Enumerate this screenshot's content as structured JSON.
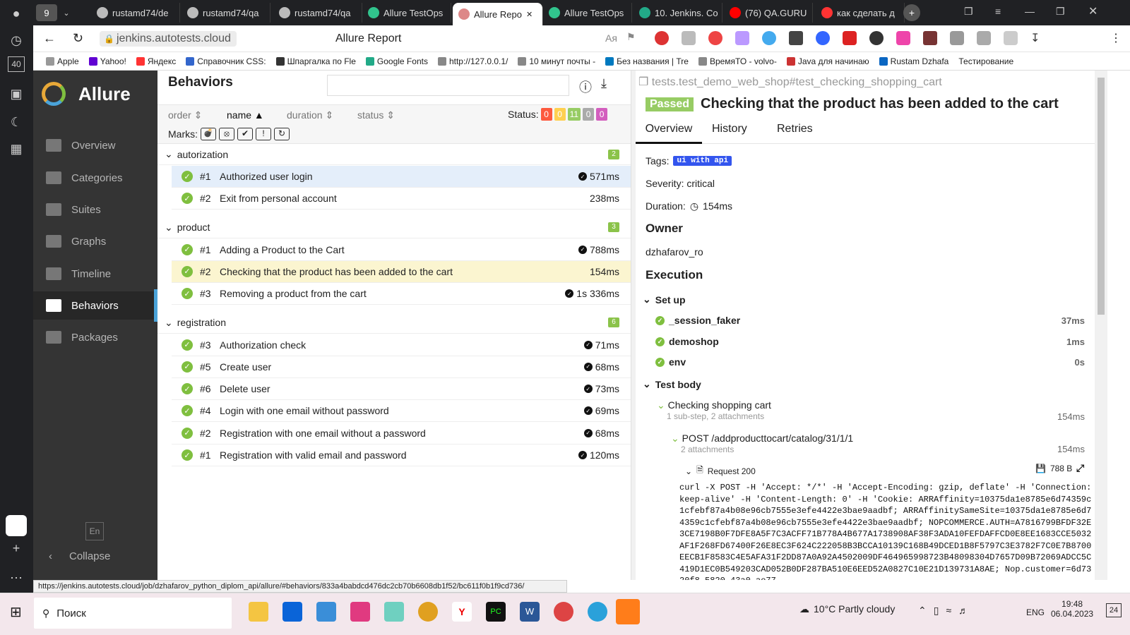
{
  "browser": {
    "tab_count": "9",
    "tabs": [
      {
        "label": "rustamd74/de",
        "color": "#bbb"
      },
      {
        "label": "rustamd74/qa",
        "color": "#bbb"
      },
      {
        "label": "rustamd74/qa",
        "color": "#bbb"
      },
      {
        "label": "Allure TestOps",
        "color": "#31c48d"
      },
      {
        "label": "Allure Repo",
        "color": "#d88"
      },
      {
        "label": "Allure TestOps",
        "color": "#31c48d"
      },
      {
        "label": "10. Jenkins. Co",
        "color": "#2a8"
      },
      {
        "label": "(76) QA.GURU",
        "color": "#f00"
      },
      {
        "label": "как сделать д",
        "color": "#f33"
      }
    ],
    "url": "jenkins.autotests.cloud",
    "page_title": "Allure Report",
    "side_badge": "40",
    "bookmarks": [
      "Apple",
      "Yahoo!",
      "Яндекс",
      "Справочник CSS:",
      "Шпаргалка по Fle",
      "Google Fonts",
      "http://127.0.0.1/",
      "10 минут почты -",
      "Без названия | Tre",
      "ВремяТО - volvo-",
      "Java для начинаю",
      "Rustam Dzhafa",
      "Тестирование"
    ],
    "status_url": "https://jenkins.autotests.cloud/job/dzhafarov_python_diplom_api/allure/#behaviors/833a4babdcd476dc2cb70b6608db1f52/bc611f0b1f9cd736/"
  },
  "sidebar": {
    "brand": "Allure",
    "items": [
      {
        "label": "Overview",
        "icon": "home-icon"
      },
      {
        "label": "Categories",
        "icon": "flag-icon"
      },
      {
        "label": "Suites",
        "icon": "briefcase-icon"
      },
      {
        "label": "Graphs",
        "icon": "bar-chart-icon"
      },
      {
        "label": "Timeline",
        "icon": "clock-icon"
      },
      {
        "label": "Behaviors",
        "icon": "list-icon"
      },
      {
        "label": "Packages",
        "icon": "align-left-icon"
      }
    ],
    "lang": "En",
    "collapse": "Collapse"
  },
  "behaviors": {
    "title": "Behaviors",
    "sort": {
      "order": "order",
      "name": "name",
      "duration": "duration",
      "status": "status"
    },
    "status_label": "Status:",
    "status_counts": [
      {
        "value": "0",
        "color": "#fd5a3e"
      },
      {
        "value": "0",
        "color": "#ffd050"
      },
      {
        "value": "11",
        "color": "#97cc64"
      },
      {
        "value": "0",
        "color": "#aaaaaa"
      },
      {
        "value": "0",
        "color": "#d35ebe"
      }
    ],
    "marks_label": "Marks:",
    "groups": [
      {
        "name": "autorization",
        "count": "2",
        "tests": [
          {
            "num": "#1",
            "name": "Authorized user login",
            "dur": "571ms",
            "mark": true
          },
          {
            "num": "#2",
            "name": "Exit from personal account",
            "dur": "238ms",
            "mark": false
          }
        ]
      },
      {
        "name": "product",
        "count": "3",
        "tests": [
          {
            "num": "#1",
            "name": "Adding a Product to the Cart",
            "dur": "788ms",
            "mark": true
          },
          {
            "num": "#2",
            "name": "Checking that the product has been added to the cart",
            "dur": "154ms",
            "mark": false
          },
          {
            "num": "#3",
            "name": "Removing a product from the cart",
            "dur": "1s 336ms",
            "mark": true
          }
        ]
      },
      {
        "name": "registration",
        "count": "6",
        "tests": [
          {
            "num": "#3",
            "name": "Authorization check",
            "dur": "71ms",
            "mark": true
          },
          {
            "num": "#5",
            "name": "Create user",
            "dur": "68ms",
            "mark": true
          },
          {
            "num": "#6",
            "name": "Delete user",
            "dur": "73ms",
            "mark": true
          },
          {
            "num": "#4",
            "name": "Login with one email without password",
            "dur": "69ms",
            "mark": true
          },
          {
            "num": "#2",
            "name": "Registration with one email without a password",
            "dur": "68ms",
            "mark": true
          },
          {
            "num": "#1",
            "name": "Registration with valid email and password",
            "dur": "120ms",
            "mark": true
          }
        ]
      }
    ]
  },
  "detail": {
    "path": "tests.test_demo_web_shop#test_checking_shopping_cart",
    "status": "Passed",
    "title": "Checking that the product has been added to the cart",
    "tabs": [
      "Overview",
      "History",
      "Retries"
    ],
    "tags_label": "Tags:",
    "tag": "ui with api",
    "severity": "Severity: critical",
    "duration_label": "Duration:",
    "duration": "154ms",
    "owner_heading": "Owner",
    "owner": "dzhafarov_ro",
    "execution_heading": "Execution",
    "setup_label": "Set up",
    "setup": [
      {
        "name": "_session_faker",
        "dur": "37ms"
      },
      {
        "name": "demoshop",
        "dur": "1ms"
      },
      {
        "name": "env",
        "dur": "0s"
      }
    ],
    "body_label": "Test body",
    "step1": {
      "name": "Checking shopping cart",
      "sub": "1 sub-step, 2 attachments",
      "dur": "154ms"
    },
    "step2": {
      "name": "POST /addproducttocart/catalog/31/1/1",
      "sub": "2 attachments",
      "dur": "154ms"
    },
    "attachment": {
      "name": "Request 200",
      "size": "788 B"
    },
    "curl": "curl -X POST -H 'Accept: */*' -H 'Accept-Encoding: gzip, deflate' -H 'Connection: keep-alive' -H 'Content-Length: 0' -H 'Cookie: ARRAffinity=10375da1e8785e6d74359c1cfebf87a4b08e96cb7555e3efe4422e3bae9aadbf; ARRAffinitySameSite=10375da1e8785e6d74359c1cfebf87a4b08e96cb7555e3efe4422e3bae9aadbf; NOPCOMMERCE.AUTH=A7816799BFDF32E3CE7198B0F7DFE8A5F7C3ACFF71B778A4B677A1738908AF38F3ADA10FEFDAFFCD0E8EE1683CCE5032AF1F268FD67400F26E8EC3F624C222058B3BCCA10139C168B49DCED1B8F5797C3E3782F7C0E7B8700EECB1F8583C4E5AFA31F2DD87A0A92A4502009DF464965998723B48098304D7657D09B72069ADCC5C419D1EC0B549203CAD052B0DF287BA510E6EED52A0827C10E21D139731A8AE; Nop.customer=6d7320f8-5820-43a0-ae77-"
  },
  "taskbar": {
    "search": "Поиск",
    "weather": "10°C  Partly cloudy",
    "lang": "ENG",
    "time": "19:48",
    "date": "06.04.2023",
    "notif": "24"
  }
}
